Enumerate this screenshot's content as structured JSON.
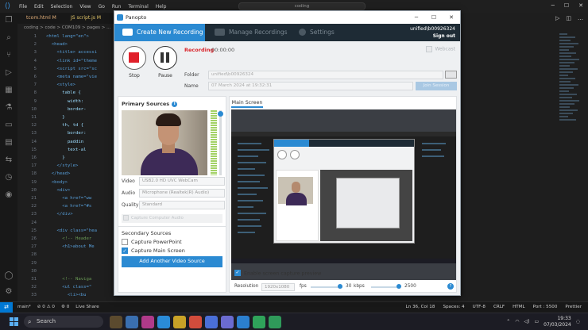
{
  "vscode": {
    "menu": [
      "File",
      "Edit",
      "Selection",
      "View",
      "Go",
      "Run",
      "Terminal",
      "Help"
    ],
    "search": "coding",
    "tabs": [
      {
        "label": "tcom.html M"
      },
      {
        "label": "JS script.js M"
      }
    ],
    "breadcrumb": "coding > code > COM109 > pages > ...",
    "line_numbers": [
      "1",
      "2",
      "3",
      "4",
      "5",
      "6",
      "7",
      "8",
      "9",
      "10",
      "11",
      "12",
      "13",
      "14",
      "15",
      "16",
      "17",
      "18",
      "19",
      "20",
      "21",
      "22",
      "23",
      "24",
      "25",
      "26",
      "27",
      "28",
      "29",
      "30",
      "31",
      "32",
      "33"
    ],
    "code_lines": [
      "<html lang=\"en\">",
      "  <head>",
      "    <title> accessi",
      "    <link id=\"theme",
      "    <script src=\"sc",
      "    <meta name=\"vie",
      "    <style>",
      "      table {",
      "        width:",
      "        border-",
      "      }",
      "      th, td {",
      "        border:",
      "        paddin",
      "        text-al",
      "      }",
      "    </style>",
      "  </head>",
      "  <body>",
      "    <div>",
      "      <a href=\"ww",
      "      <a href=\"#s",
      "    </div>",
      "",
      "    <div class=\"hea",
      "      <!-- Header",
      "      <h1>about Me",
      "",
      "",
      "",
      "      <!-- Naviga",
      "      <ul class=\"",
      "        <li><bu",
      "        <li><bu",
      "        <li><bu",
      "      </ul>"
    ],
    "status_left": [
      "main*",
      "⊘ 0 ⚠ 0",
      "⚙ 0",
      "Live Share"
    ],
    "status_right": [
      "Ln 36, Col 18",
      "Spaces: 4",
      "UTF-8",
      "CRLF",
      "HTML",
      "Port : 5500",
      "Prettier"
    ]
  },
  "taskbar": {
    "search_placeholder": "Search",
    "time": "19:33",
    "date": "07/03/2024"
  },
  "panopto": {
    "window_title": "Panopto",
    "tabs": {
      "create": "Create New Recording",
      "manage": "Manage Recordings",
      "settings": "Settings"
    },
    "user": "unified\\b00926324",
    "sign_out": "Sign out",
    "stop_label": "Stop",
    "pause_label": "Pause",
    "recording_label": "Recording",
    "recording_time": "00:00:00",
    "webcast_label": "Webcast",
    "folder_label": "Folder",
    "folder_value": "unified\\b00926324",
    "name_label": "Name",
    "name_value": "07 March 2024 at 19:32:31",
    "join_label": "Join Session",
    "primary_sources_title": "Primary Sources",
    "video_label": "Video",
    "video_value": "USB2.0 HD UVC WebCam",
    "audio_label": "Audio",
    "audio_value": "Microphone (Realtek(R) Audio)",
    "quality_label": "Quality",
    "quality_value": "Standard",
    "capture_computer_audio": "Capture Computer Audio",
    "secondary_sources_title": "Secondary Sources",
    "capture_powerpoint": "Capture PowerPoint",
    "capture_main_screen": "Capture Main Screen",
    "add_video_source": "Add Another Video Source",
    "main_screen_tab": "Main Screen",
    "enable_preview": "Enable screen capture preview",
    "resolution_label": "Resolution",
    "resolution_value": "1920x1080",
    "fps_label": "fps",
    "fps_value": "30",
    "kbps_label": "kbps",
    "kbps_value": "2500",
    "colors": {
      "accent": "#2b8ad2",
      "nav": "#1e2b35",
      "record": "#d9242b"
    }
  }
}
